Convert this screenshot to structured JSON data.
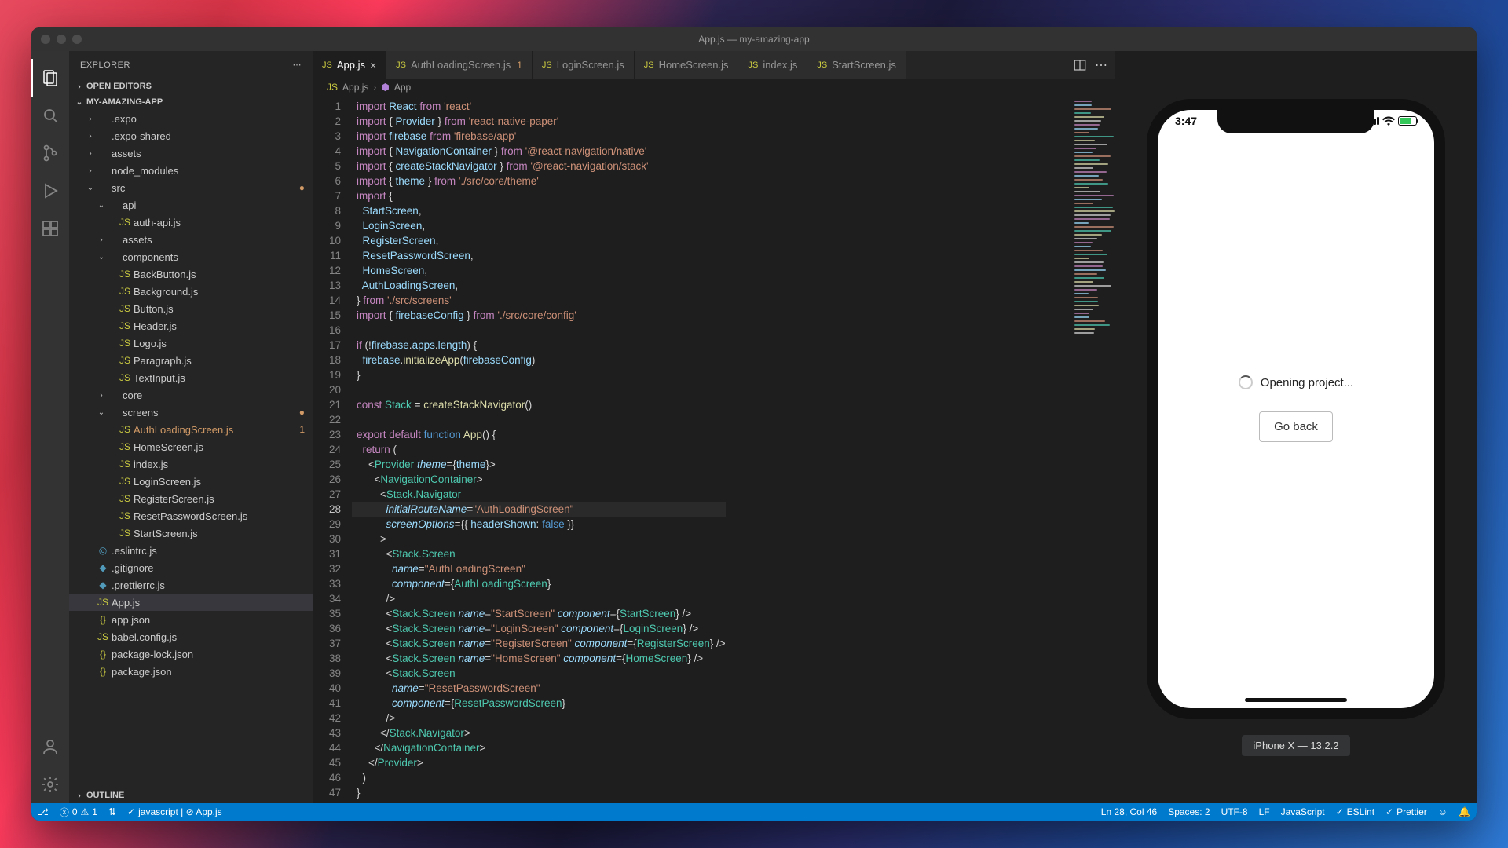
{
  "titlebar": {
    "title": "App.js — my-amazing-app"
  },
  "sidebar": {
    "header": "EXPLORER",
    "open_editors": "OPEN EDITORS",
    "outline": "OUTLINE",
    "project": "MY-AMAZING-APP",
    "tree": [
      {
        "d": 1,
        "t": "folder",
        "c": false,
        "n": ".expo"
      },
      {
        "d": 1,
        "t": "folder",
        "c": false,
        "n": ".expo-shared"
      },
      {
        "d": 1,
        "t": "folder",
        "c": false,
        "n": "assets"
      },
      {
        "d": 1,
        "t": "folder",
        "c": false,
        "n": "node_modules"
      },
      {
        "d": 1,
        "t": "folder",
        "c": true,
        "n": "src",
        "mod": "●"
      },
      {
        "d": 2,
        "t": "folder",
        "c": true,
        "n": "api"
      },
      {
        "d": 3,
        "t": "js",
        "n": "auth-api.js"
      },
      {
        "d": 2,
        "t": "folder",
        "c": false,
        "n": "assets"
      },
      {
        "d": 2,
        "t": "folder",
        "c": true,
        "n": "components"
      },
      {
        "d": 3,
        "t": "js",
        "n": "BackButton.js"
      },
      {
        "d": 3,
        "t": "js",
        "n": "Background.js"
      },
      {
        "d": 3,
        "t": "js",
        "n": "Button.js"
      },
      {
        "d": 3,
        "t": "js",
        "n": "Header.js"
      },
      {
        "d": 3,
        "t": "js",
        "n": "Logo.js"
      },
      {
        "d": 3,
        "t": "js",
        "n": "Paragraph.js"
      },
      {
        "d": 3,
        "t": "js",
        "n": "TextInput.js"
      },
      {
        "d": 2,
        "t": "folder",
        "c": false,
        "n": "core"
      },
      {
        "d": 2,
        "t": "folder",
        "c": true,
        "n": "screens",
        "mod": "●"
      },
      {
        "d": 3,
        "t": "js",
        "n": "AuthLoadingScreen.js",
        "mod": "1",
        "modset": true
      },
      {
        "d": 3,
        "t": "js",
        "n": "HomeScreen.js"
      },
      {
        "d": 3,
        "t": "js",
        "n": "index.js"
      },
      {
        "d": 3,
        "t": "js",
        "n": "LoginScreen.js"
      },
      {
        "d": 3,
        "t": "js",
        "n": "RegisterScreen.js"
      },
      {
        "d": 3,
        "t": "js",
        "n": "ResetPasswordScreen.js"
      },
      {
        "d": 3,
        "t": "js",
        "n": "StartScreen.js"
      },
      {
        "d": 1,
        "t": "eslint",
        "n": ".eslintrc.js"
      },
      {
        "d": 1,
        "t": "dot",
        "n": ".gitignore"
      },
      {
        "d": 1,
        "t": "dot",
        "n": ".prettierrc.js"
      },
      {
        "d": 1,
        "t": "js",
        "n": "App.js",
        "sel": true
      },
      {
        "d": 1,
        "t": "json",
        "n": "app.json"
      },
      {
        "d": 1,
        "t": "js",
        "n": "babel.config.js"
      },
      {
        "d": 1,
        "t": "json",
        "n": "package-lock.json"
      },
      {
        "d": 1,
        "t": "json",
        "n": "package.json"
      }
    ]
  },
  "tabs": [
    {
      "label": "App.js",
      "icon": "JS",
      "active": true,
      "close": true
    },
    {
      "label": "AuthLoadingScreen.js",
      "icon": "JS",
      "mod": "1"
    },
    {
      "label": "LoginScreen.js",
      "icon": "JS"
    },
    {
      "label": "HomeScreen.js",
      "icon": "JS"
    },
    {
      "label": "index.js",
      "icon": "JS"
    },
    {
      "label": "StartScreen.js",
      "icon": "JS"
    }
  ],
  "breadcrumb": {
    "file": "App.js",
    "symbol": "App"
  },
  "code": [
    [
      [
        "k",
        "import"
      ],
      [
        "pn",
        " "
      ],
      [
        "v",
        "React"
      ],
      [
        "pn",
        " "
      ],
      [
        "k",
        "from"
      ],
      [
        "pn",
        " "
      ],
      [
        "s",
        "'react'"
      ]
    ],
    [
      [
        "k",
        "import"
      ],
      [
        "pn",
        " { "
      ],
      [
        "v",
        "Provider"
      ],
      [
        "pn",
        " } "
      ],
      [
        "k",
        "from"
      ],
      [
        "pn",
        " "
      ],
      [
        "s",
        "'react-native-paper'"
      ]
    ],
    [
      [
        "k",
        "import"
      ],
      [
        "pn",
        " "
      ],
      [
        "v",
        "firebase"
      ],
      [
        "pn",
        " "
      ],
      [
        "k",
        "from"
      ],
      [
        "pn",
        " "
      ],
      [
        "s",
        "'firebase/app'"
      ]
    ],
    [
      [
        "k",
        "import"
      ],
      [
        "pn",
        " { "
      ],
      [
        "v",
        "NavigationContainer"
      ],
      [
        "pn",
        " } "
      ],
      [
        "k",
        "from"
      ],
      [
        "pn",
        " "
      ],
      [
        "s",
        "'@react-navigation/native'"
      ]
    ],
    [
      [
        "k",
        "import"
      ],
      [
        "pn",
        " { "
      ],
      [
        "v",
        "createStackNavigator"
      ],
      [
        "pn",
        " } "
      ],
      [
        "k",
        "from"
      ],
      [
        "pn",
        " "
      ],
      [
        "s",
        "'@react-navigation/stack'"
      ]
    ],
    [
      [
        "k",
        "import"
      ],
      [
        "pn",
        " { "
      ],
      [
        "v",
        "theme"
      ],
      [
        "pn",
        " } "
      ],
      [
        "k",
        "from"
      ],
      [
        "pn",
        " "
      ],
      [
        "s",
        "'./src/core/theme'"
      ]
    ],
    [
      [
        "k",
        "import"
      ],
      [
        "pn",
        " {"
      ]
    ],
    [
      [
        "pn",
        "  "
      ],
      [
        "v",
        "StartScreen"
      ],
      [
        "pn",
        ","
      ]
    ],
    [
      [
        "pn",
        "  "
      ],
      [
        "v",
        "LoginScreen"
      ],
      [
        "pn",
        ","
      ]
    ],
    [
      [
        "pn",
        "  "
      ],
      [
        "v",
        "RegisterScreen"
      ],
      [
        "pn",
        ","
      ]
    ],
    [
      [
        "pn",
        "  "
      ],
      [
        "v",
        "ResetPasswordScreen"
      ],
      [
        "pn",
        ","
      ]
    ],
    [
      [
        "pn",
        "  "
      ],
      [
        "v",
        "HomeScreen"
      ],
      [
        "pn",
        ","
      ]
    ],
    [
      [
        "pn",
        "  "
      ],
      [
        "v",
        "AuthLoadingScreen"
      ],
      [
        "pn",
        ","
      ]
    ],
    [
      [
        "pn",
        "} "
      ],
      [
        "k",
        "from"
      ],
      [
        "pn",
        " "
      ],
      [
        "s",
        "'./src/screens'"
      ]
    ],
    [
      [
        "k",
        "import"
      ],
      [
        "pn",
        " { "
      ],
      [
        "v",
        "firebaseConfig"
      ],
      [
        "pn",
        " } "
      ],
      [
        "k",
        "from"
      ],
      [
        "pn",
        " "
      ],
      [
        "s",
        "'./src/core/config'"
      ]
    ],
    [],
    [
      [
        "k",
        "if"
      ],
      [
        "pn",
        " ("
      ],
      [
        "pn",
        "!"
      ],
      [
        "v",
        "firebase"
      ],
      [
        "pn",
        "."
      ],
      [
        "v",
        "apps"
      ],
      [
        "pn",
        "."
      ],
      [
        "v",
        "length"
      ],
      [
        "pn",
        ") {"
      ]
    ],
    [
      [
        "pn",
        "  "
      ],
      [
        "v",
        "firebase"
      ],
      [
        "pn",
        "."
      ],
      [
        "fn",
        "initializeApp"
      ],
      [
        "pn",
        "("
      ],
      [
        "v",
        "firebaseConfig"
      ],
      [
        "pn",
        ")"
      ]
    ],
    [
      [
        "pn",
        "}"
      ]
    ],
    [],
    [
      [
        "k",
        "const"
      ],
      [
        "pn",
        " "
      ],
      [
        "ty",
        "Stack"
      ],
      [
        "pn",
        " = "
      ],
      [
        "fn",
        "createStackNavigator"
      ],
      [
        "pn",
        "()"
      ]
    ],
    [],
    [
      [
        "k",
        "export"
      ],
      [
        "pn",
        " "
      ],
      [
        "k",
        "default"
      ],
      [
        "pn",
        " "
      ],
      [
        "cst",
        "function"
      ],
      [
        "pn",
        " "
      ],
      [
        "fn",
        "App"
      ],
      [
        "pn",
        "() {"
      ]
    ],
    [
      [
        "pn",
        "  "
      ],
      [
        "k",
        "return"
      ],
      [
        "pn",
        " ("
      ]
    ],
    [
      [
        "pn",
        "    <"
      ],
      [
        "tg",
        "Provider"
      ],
      [
        "pn",
        " "
      ],
      [
        "at",
        "theme"
      ],
      [
        "pn",
        "={"
      ],
      [
        "v",
        "theme"
      ],
      [
        "pn",
        "}>"
      ]
    ],
    [
      [
        "pn",
        "      <"
      ],
      [
        "tg",
        "NavigationContainer"
      ],
      [
        "pn",
        ">"
      ]
    ],
    [
      [
        "pn",
        "        <"
      ],
      [
        "tg",
        "Stack.Navigator"
      ]
    ],
    [
      [
        "pn",
        "          "
      ],
      [
        "at",
        "initialRouteName"
      ],
      [
        "pn",
        "="
      ],
      [
        "s",
        "\"AuthLoadingScreen\""
      ]
    ],
    [
      [
        "pn",
        "          "
      ],
      [
        "at",
        "screenOptions"
      ],
      [
        "pn",
        "={{ "
      ],
      [
        "v",
        "headerShown"
      ],
      [
        "pn",
        ": "
      ],
      [
        "cst",
        "false"
      ],
      [
        "pn",
        " }}"
      ]
    ],
    [
      [
        "pn",
        "        >"
      ]
    ],
    [
      [
        "pn",
        "          <"
      ],
      [
        "tg",
        "Stack.Screen"
      ]
    ],
    [
      [
        "pn",
        "            "
      ],
      [
        "at",
        "name"
      ],
      [
        "pn",
        "="
      ],
      [
        "s",
        "\"AuthLoadingScreen\""
      ]
    ],
    [
      [
        "pn",
        "            "
      ],
      [
        "at",
        "component"
      ],
      [
        "pn",
        "={"
      ],
      [
        "ty",
        "AuthLoadingScreen"
      ],
      [
        "pn",
        "}"
      ]
    ],
    [
      [
        "pn",
        "          />"
      ]
    ],
    [
      [
        "pn",
        "          <"
      ],
      [
        "tg",
        "Stack.Screen"
      ],
      [
        "pn",
        " "
      ],
      [
        "at",
        "name"
      ],
      [
        "pn",
        "="
      ],
      [
        "s",
        "\"StartScreen\""
      ],
      [
        "pn",
        " "
      ],
      [
        "at",
        "component"
      ],
      [
        "pn",
        "={"
      ],
      [
        "ty",
        "StartScreen"
      ],
      [
        "pn",
        "} />"
      ]
    ],
    [
      [
        "pn",
        "          <"
      ],
      [
        "tg",
        "Stack.Screen"
      ],
      [
        "pn",
        " "
      ],
      [
        "at",
        "name"
      ],
      [
        "pn",
        "="
      ],
      [
        "s",
        "\"LoginScreen\""
      ],
      [
        "pn",
        " "
      ],
      [
        "at",
        "component"
      ],
      [
        "pn",
        "={"
      ],
      [
        "ty",
        "LoginScreen"
      ],
      [
        "pn",
        "} />"
      ]
    ],
    [
      [
        "pn",
        "          <"
      ],
      [
        "tg",
        "Stack.Screen"
      ],
      [
        "pn",
        " "
      ],
      [
        "at",
        "name"
      ],
      [
        "pn",
        "="
      ],
      [
        "s",
        "\"RegisterScreen\""
      ],
      [
        "pn",
        " "
      ],
      [
        "at",
        "component"
      ],
      [
        "pn",
        "={"
      ],
      [
        "ty",
        "RegisterScreen"
      ],
      [
        "pn",
        "} />"
      ]
    ],
    [
      [
        "pn",
        "          <"
      ],
      [
        "tg",
        "Stack.Screen"
      ],
      [
        "pn",
        " "
      ],
      [
        "at",
        "name"
      ],
      [
        "pn",
        "="
      ],
      [
        "s",
        "\"HomeScreen\""
      ],
      [
        "pn",
        " "
      ],
      [
        "at",
        "component"
      ],
      [
        "pn",
        "={"
      ],
      [
        "ty",
        "HomeScreen"
      ],
      [
        "pn",
        "} />"
      ]
    ],
    [
      [
        "pn",
        "          <"
      ],
      [
        "tg",
        "Stack.Screen"
      ]
    ],
    [
      [
        "pn",
        "            "
      ],
      [
        "at",
        "name"
      ],
      [
        "pn",
        "="
      ],
      [
        "s",
        "\"ResetPasswordScreen\""
      ]
    ],
    [
      [
        "pn",
        "            "
      ],
      [
        "at",
        "component"
      ],
      [
        "pn",
        "={"
      ],
      [
        "ty",
        "ResetPasswordScreen"
      ],
      [
        "pn",
        "}"
      ]
    ],
    [
      [
        "pn",
        "          />"
      ]
    ],
    [
      [
        "pn",
        "        </"
      ],
      [
        "tg",
        "Stack.Navigator"
      ],
      [
        "pn",
        ">"
      ]
    ],
    [
      [
        "pn",
        "      </"
      ],
      [
        "tg",
        "NavigationContainer"
      ],
      [
        "pn",
        ">"
      ]
    ],
    [
      [
        "pn",
        "    </"
      ],
      [
        "tg",
        "Provider"
      ],
      [
        "pn",
        ">"
      ]
    ],
    [
      [
        "pn",
        "  )"
      ]
    ],
    [
      [
        "pn",
        "}"
      ]
    ]
  ],
  "current_line": 28,
  "statusbar": {
    "branch": "⎇",
    "errors": "0",
    "warnings": "1",
    "port": "⇅",
    "lang_check": "javascript | ⊘ App.js",
    "cursor": "Ln 28, Col 46",
    "spaces": "Spaces: 2",
    "encoding": "UTF-8",
    "eol": "LF",
    "lang": "JavaScript",
    "eslint": "ESLint",
    "prettier": "Prettier"
  },
  "phone": {
    "time": "3:47",
    "message": "Opening project...",
    "button": "Go back",
    "label": "iPhone X — 13.2.2"
  }
}
